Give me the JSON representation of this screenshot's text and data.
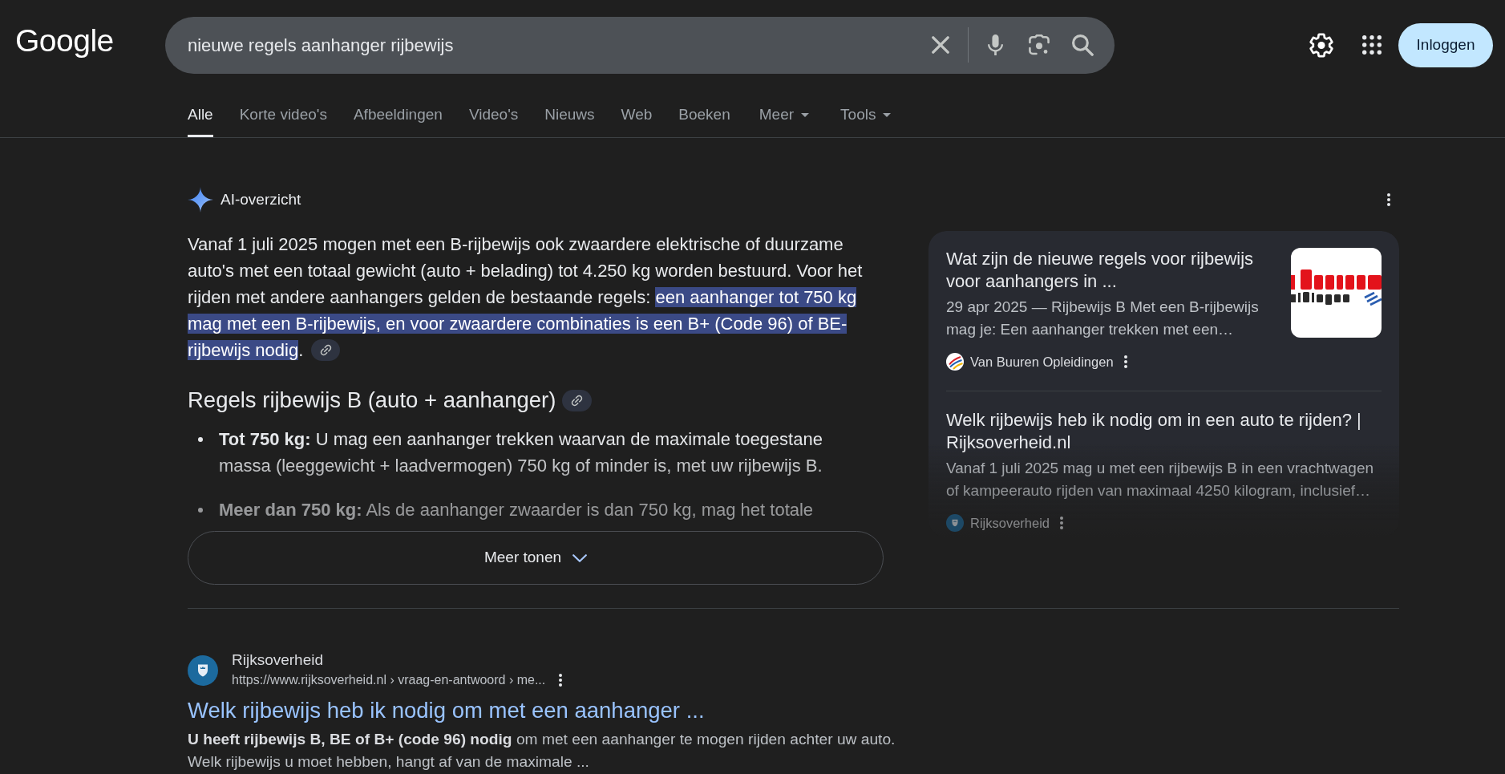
{
  "header": {
    "logo": "Google",
    "search": {
      "value": "nieuwe regels aanhanger rijbewijs"
    },
    "sign_in_button": "Inloggen"
  },
  "tabs": [
    {
      "label": "Alle",
      "selected": true,
      "kind": "tab"
    },
    {
      "label": "Korte video's",
      "selected": false,
      "kind": "tab"
    },
    {
      "label": "Afbeeldingen",
      "selected": false,
      "kind": "tab"
    },
    {
      "label": "Video's",
      "selected": false,
      "kind": "tab"
    },
    {
      "label": "Nieuws",
      "selected": false,
      "kind": "tab"
    },
    {
      "label": "Web",
      "selected": false,
      "kind": "tab"
    },
    {
      "label": "Boeken",
      "selected": false,
      "kind": "tab"
    },
    {
      "label": "Meer",
      "selected": false,
      "kind": "dropdown"
    },
    {
      "label": "Tools",
      "selected": false,
      "kind": "dropdown"
    }
  ],
  "ai_overview": {
    "title": "AI-overzicht",
    "summary": [
      {
        "text": "Vanaf 1 juli 2025 mogen met een B-rijbewijs ook zwaardere elektrische of duurzame auto's met een totaal gewicht (auto + belading) tot 4.250 kg worden bestuurd. Voor het rijden met andere aanhangers gelden de bestaande regels: ",
        "highlighted": false
      },
      {
        "text": "een aanhanger tot 750 kg mag met een B-rijbewijs, en voor zwaardere combinaties is een B+ (Code 96) of BE-rijbewijs nodig",
        "highlighted": true
      },
      {
        "text": ".",
        "highlighted": false
      }
    ],
    "sections": [
      {
        "heading": "Regels rijbewijs B (auto + aanhanger)",
        "items": [
          "**Tot 750 kg:** U mag een aanhanger trekken waarvan de maximale toegestane massa (leeggewicht + laadvermogen) 750 kg of minder is, met uw rijbewijs B.",
          "**Meer dan 750 kg:** Als de aanhanger zwaarder is dan 750 kg, mag het totale"
        ]
      }
    ],
    "expanded": false,
    "more_button": "Meer tonen",
    "sources": [
      {
        "title": "Wat zijn de nieuwe regels voor rijbewijs voor aanhangers in ...",
        "snippet": "29 apr 2025 — Rijbewijs B Met een B-rijbewijs mag je: Een aanhanger trekken met een…",
        "site": "Van Buuren Opleidingen",
        "thumbnail": true
      },
      {
        "title": "Welk rijbewijs heb ik nodig om in een auto te rijden? | Rijksoverheid.nl",
        "snippet": "Vanaf 1 juli 2025 mag u met een rijbewijs B in een vrachtwagen of kampeerauto rijden van maximaal 4250 kilogram, inclusief…",
        "site": "Rijksoverheid",
        "thumbnail": false
      }
    ]
  },
  "results": [
    {
      "site": "Rijksoverheid",
      "url": "https://www.rijksoverheid.nl › vraag-en-antwoord › me...",
      "title": "Welk rijbewijs heb ik nodig om met een aanhanger ...",
      "snippet": "**U heeft rijbewijs B, BE of B+ (code 96) nodig** om met een aanhanger te mogen rijden achter uw auto. Welk rijbewijs u moet hebben, hangt af van de maximale ..."
    }
  ]
}
